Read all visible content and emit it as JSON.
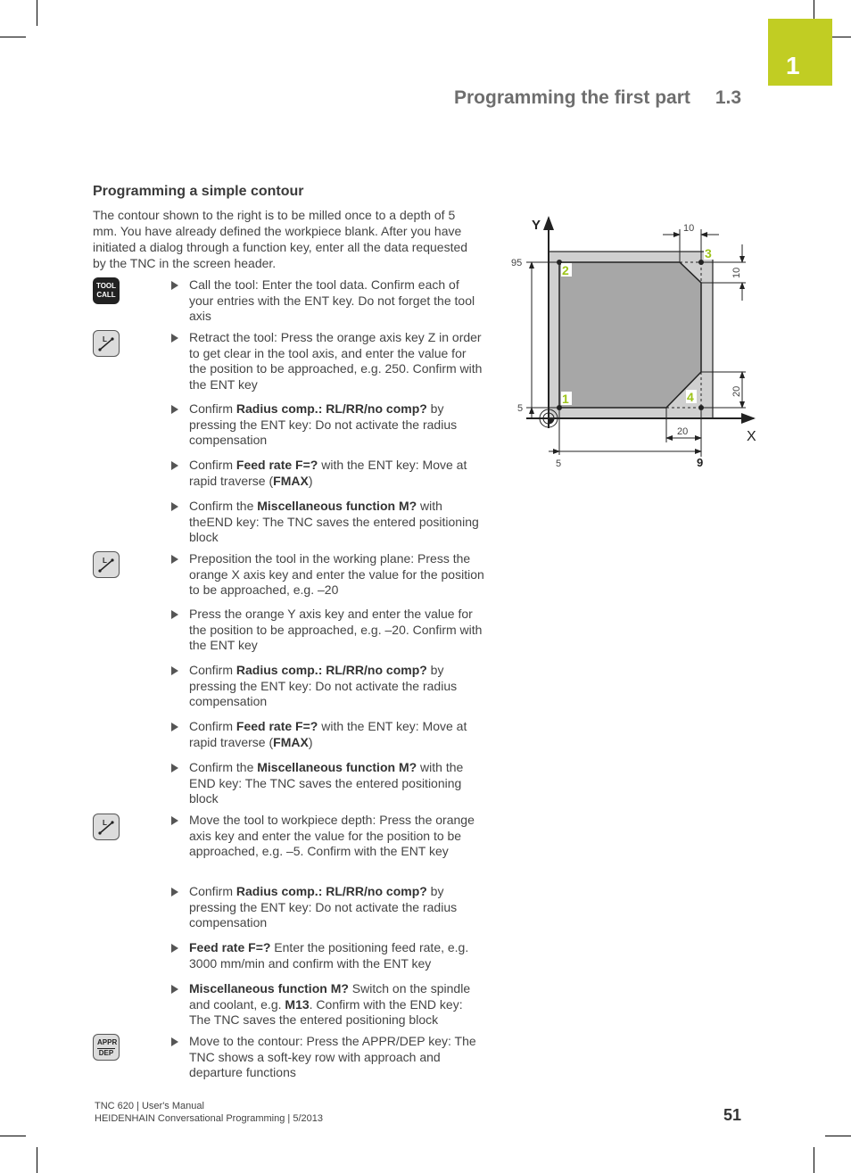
{
  "chapter": {
    "number": "1"
  },
  "running_head": {
    "title": "Programming the first part",
    "section": "1.3"
  },
  "section": {
    "title": "Programming a simple contour",
    "intro": "The contour shown to the right is to be milled once to a depth of 5 mm. You have already defined the workpiece blank. After you have initiated a dialog through a function key, enter all the data requested by the TNC in the screen header."
  },
  "keys": [
    {
      "icon": "tool-call-key",
      "lines": [
        "TOOL",
        "CALL"
      ]
    },
    {
      "icon": "linear-move-key",
      "label": "L"
    },
    {
      "icon": "linear-move-key",
      "label": "L"
    },
    {
      "icon": "linear-move-key",
      "label": "L"
    },
    {
      "icon": "appr-dep-key",
      "lines": [
        "APPR",
        "DEP"
      ]
    }
  ],
  "steps": [
    {
      "pre": "Call the tool: Enter the tool data. Confirm each of your entries with the ENT key. Do not forget the tool axis",
      "bold": "",
      "post": ""
    },
    {
      "pre": "Retract the tool: Press the orange axis key Z in order to get clear in the tool axis, and enter the value for the position to be approached, e.g. 250. Confirm with the ENT key",
      "bold": "",
      "post": ""
    },
    {
      "pre": "Confirm ",
      "bold": "Radius comp.: RL/RR/no comp?",
      "post": " by pressing the ENT key: Do not activate the radius compensation"
    },
    {
      "pre": "Confirm ",
      "bold": "Feed rate F=?",
      "post": " with the ENT key: Move at rapid traverse (",
      "bold2": "FMAX",
      "post2": ")"
    },
    {
      "pre": "Confirm the ",
      "bold": "Miscellaneous function M?",
      "post": " with theEND key: The TNC saves the entered positioning block"
    },
    {
      "pre": "Preposition the tool in the working plane: Press the orange X axis key and enter the value for the position to be approached, e.g. –20",
      "bold": "",
      "post": ""
    },
    {
      "pre": "Press the orange Y axis key and enter the value for the position to be approached, e.g. –20. Confirm with the ENT key",
      "bold": "",
      "post": ""
    },
    {
      "pre": "Confirm ",
      "bold": "Radius comp.: RL/RR/no comp?",
      "post": " by pressing the ENT key: Do not activate the radius compensation"
    },
    {
      "pre": "Confirm ",
      "bold": "Feed rate F=?",
      "post": " with the ENT key: Move at rapid traverse (",
      "bold2": "FMAX",
      "post2": ")"
    },
    {
      "pre": "Confirm the ",
      "bold": "Miscellaneous function M?",
      "post": " with the END key: The TNC saves the entered positioning block"
    },
    {
      "pre": "Move the tool to workpiece depth: Press the orange axis key and enter the value for the position to be approached, e.g. –5. Confirm with the ENT key",
      "bold": "",
      "post": ""
    },
    {
      "pre": "Confirm ",
      "bold": "Radius comp.: RL/RR/no comp?",
      "post": " by pressing the ENT key: Do not activate the radius compensation"
    },
    {
      "pre": "",
      "bold": "Feed rate F=?",
      "post": " Enter the positioning feed rate, e.g. 3000 mm/min and confirm with the ENT key"
    },
    {
      "pre": "",
      "bold": "Miscellaneous function M?",
      "post": " Switch on the spindle and coolant, e.g. ",
      "bold2": "M13",
      "post2": ". Confirm with the END key: The TNC saves the entered positioning block"
    },
    {
      "pre": "Move to the contour: Press the APPR/DEP key: The TNC shows a soft-key row with approach and departure functions",
      "bold": "",
      "post": ""
    }
  ],
  "diagram": {
    "axis_x": "X",
    "axis_y": "Y",
    "points": [
      "1",
      "2",
      "3",
      "4"
    ],
    "dims": {
      "y_top": "95",
      "y_bottom": "5",
      "x_left": "5",
      "x_right": "9",
      "chamfer_top_x": "10",
      "chamfer_top_y": "10",
      "chamfer_bottom_x": "20",
      "chamfer_bottom_y": "20"
    },
    "colors": {
      "point_label": "#9dc41a",
      "contour_fill": "#a7a7a7",
      "blank_fill": "#cfcfcf"
    }
  },
  "footer": {
    "line1": "TNC 620 | User's Manual",
    "line2": "HEIDENHAIN Conversational Programming | 5/2013",
    "page": "51"
  }
}
